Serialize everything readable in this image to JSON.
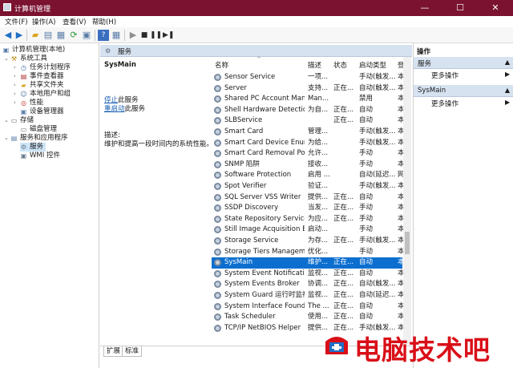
{
  "window": {
    "title": "计算机管理",
    "min_label": "—",
    "max_label": "☐",
    "close_label": "✕"
  },
  "menu": [
    {
      "label": "文件(F)"
    },
    {
      "label": "操作(A)"
    },
    {
      "label": "查看(V)"
    },
    {
      "label": "帮助(H)"
    }
  ],
  "tree": {
    "root": "计算机管理(本地)",
    "system_tools": "系统工具",
    "task_scheduler": "任务计划程序",
    "event_viewer": "事件查看器",
    "shared_folders": "共享文件夹",
    "local_users": "本地用户和组",
    "performance": "性能",
    "device_manager": "设备管理器",
    "storage": "存储",
    "disk_management": "磁盘管理",
    "services_apps": "服务和应用程序",
    "services": "服务",
    "wmi": "WMI 控件"
  },
  "pane": {
    "header": "服务",
    "selected_name": "SysMain",
    "stop_link": "停止",
    "stop_rest": "此服务",
    "restart_link": "重启动",
    "restart_rest": "此服务",
    "desc_label": "描述:",
    "desc_text": "维护和提高一段时间内的系统性能。"
  },
  "columns": {
    "name": "名称",
    "desc": "描述",
    "status": "状态",
    "startup": "启动类型",
    "logon": "登"
  },
  "rows": [
    {
      "name": "Sensor Service",
      "desc": "一项...",
      "status": "",
      "startup": "手动(触发...",
      "logon": "本"
    },
    {
      "name": "Server",
      "desc": "支持...",
      "status": "正在...",
      "startup": "自动(触发...",
      "logon": "本"
    },
    {
      "name": "Shared PC Account Manager",
      "desc": "Man...",
      "status": "",
      "startup": "禁用",
      "logon": "本"
    },
    {
      "name": "Shell Hardware Detection",
      "desc": "为自...",
      "status": "正在...",
      "startup": "自动",
      "logon": "本"
    },
    {
      "name": "SLBService",
      "desc": "",
      "status": "正在...",
      "startup": "自动",
      "logon": "本"
    },
    {
      "name": "Smart Card",
      "desc": "管理...",
      "status": "",
      "startup": "手动(触发...",
      "logon": "本"
    },
    {
      "name": "Smart Card Device Enumer...",
      "desc": "为给...",
      "status": "",
      "startup": "手动(触发...",
      "logon": "本"
    },
    {
      "name": "Smart Card Removal Policy",
      "desc": "允许...",
      "status": "",
      "startup": "手动",
      "logon": "本"
    },
    {
      "name": "SNMP 陷阱",
      "desc": "接收...",
      "status": "",
      "startup": "手动",
      "logon": "本"
    },
    {
      "name": "Software Protection",
      "desc": "启用 ...",
      "status": "",
      "startup": "自动(延迟...",
      "logon": "网"
    },
    {
      "name": "Spot Verifier",
      "desc": "验证...",
      "status": "",
      "startup": "手动(触发...",
      "logon": "本"
    },
    {
      "name": "SQL Server VSS Writer",
      "desc": "提供...",
      "status": "正在...",
      "startup": "自动",
      "logon": "本"
    },
    {
      "name": "SSDP Discovery",
      "desc": "当发...",
      "status": "正在...",
      "startup": "手动",
      "logon": "本"
    },
    {
      "name": "State Repository Service",
      "desc": "为应...",
      "status": "正在...",
      "startup": "手动",
      "logon": "本"
    },
    {
      "name": "Still Image Acquisition Eve...",
      "desc": "启动...",
      "status": "",
      "startup": "手动",
      "logon": "本"
    },
    {
      "name": "Storage Service",
      "desc": "为存...",
      "status": "正在...",
      "startup": "手动(触发...",
      "logon": "本"
    },
    {
      "name": "Storage Tiers Management",
      "desc": "优化...",
      "status": "",
      "startup": "手动",
      "logon": "本"
    },
    {
      "name": "SysMain",
      "desc": "维护...",
      "status": "正在...",
      "startup": "自动",
      "logon": "本"
    },
    {
      "name": "System Event Notification ...",
      "desc": "监视...",
      "status": "正在...",
      "startup": "自动",
      "logon": "本"
    },
    {
      "name": "System Events Broker",
      "desc": "协调...",
      "status": "正在...",
      "startup": "自动(触发...",
      "logon": "本"
    },
    {
      "name": "System Guard 运行时监视...",
      "desc": "监视...",
      "status": "正在...",
      "startup": "自动(延迟...",
      "logon": "本"
    },
    {
      "name": "System Interface Foundati...",
      "desc": "The ...",
      "status": "正在...",
      "startup": "自动",
      "logon": "本"
    },
    {
      "name": "Task Scheduler",
      "desc": "使用...",
      "status": "正在...",
      "startup": "自动",
      "logon": "本"
    },
    {
      "name": "TCP/IP NetBIOS Helper",
      "desc": "提供...",
      "status": "正在...",
      "startup": "手动(触发...",
      "logon": "本"
    }
  ],
  "selected_row_index": 17,
  "tabs": [
    {
      "label": "扩展"
    },
    {
      "label": "标准"
    }
  ],
  "actions": {
    "title": "操作",
    "section1": "服务",
    "more1": "更多操作",
    "section2": "SysMain",
    "more2": "更多操作"
  },
  "watermark": {
    "text": "电脑技术吧"
  },
  "colors": {
    "titlebar": "#7a1230",
    "selection": "#0c6fd0",
    "watermark": "#d90f18"
  }
}
